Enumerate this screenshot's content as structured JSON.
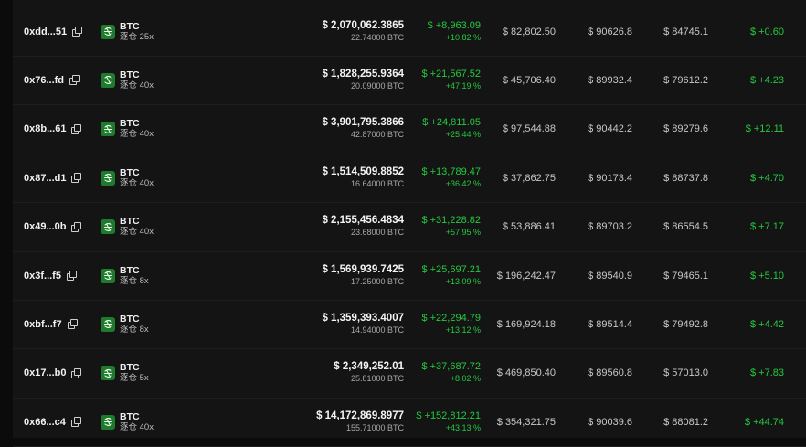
{
  "rows": [
    {
      "address": "0xdd...51",
      "coin": "BTC",
      "leverage": "逐仓 25x",
      "value": "$ 2,070,062.3865",
      "size": "22.74000 BTC",
      "pnl": "$ +8,963.09",
      "pnl_pct": "+10.82 %",
      "entry": "$ 82,802.50",
      "mark": "$ 90626.8",
      "liq": "$ 84745.1",
      "funding": "$ +0.60"
    },
    {
      "address": "0x76...fd",
      "coin": "BTC",
      "leverage": "逐仓 40x",
      "value": "$ 1,828,255.9364",
      "size": "20.09000 BTC",
      "pnl": "$ +21,567.52",
      "pnl_pct": "+47.19 %",
      "entry": "$ 45,706.40",
      "mark": "$ 89932.4",
      "liq": "$ 79612.2",
      "funding": "$ +4.23"
    },
    {
      "address": "0x8b...61",
      "coin": "BTC",
      "leverage": "逐仓 40x",
      "value": "$ 3,901,795.3866",
      "size": "42.87000 BTC",
      "pnl": "$ +24,811.05",
      "pnl_pct": "+25.44 %",
      "entry": "$ 97,544.88",
      "mark": "$ 90442.2",
      "liq": "$ 89279.6",
      "funding": "$ +12.11"
    },
    {
      "address": "0x87...d1",
      "coin": "BTC",
      "leverage": "逐仓 40x",
      "value": "$ 1,514,509.8852",
      "size": "16.64000 BTC",
      "pnl": "$ +13,789.47",
      "pnl_pct": "+36.42 %",
      "entry": "$ 37,862.75",
      "mark": "$ 90173.4",
      "liq": "$ 88737.8",
      "funding": "$ +4.70"
    },
    {
      "address": "0x49...0b",
      "coin": "BTC",
      "leverage": "逐仓 40x",
      "value": "$ 2,155,456.4834",
      "size": "23.68000 BTC",
      "pnl": "$ +31,228.82",
      "pnl_pct": "+57.95 %",
      "entry": "$ 53,886.41",
      "mark": "$ 89703.2",
      "liq": "$ 86554.5",
      "funding": "$ +7.17"
    },
    {
      "address": "0x3f...f5",
      "coin": "BTC",
      "leverage": "逐仓 8x",
      "value": "$ 1,569,939.7425",
      "size": "17.25000 BTC",
      "pnl": "$ +25,697.21",
      "pnl_pct": "+13.09 %",
      "entry": "$ 196,242.47",
      "mark": "$ 89540.9",
      "liq": "$ 79465.1",
      "funding": "$ +5.10"
    },
    {
      "address": "0xbf...f7",
      "coin": "BTC",
      "leverage": "逐仓 8x",
      "value": "$ 1,359,393.4007",
      "size": "14.94000 BTC",
      "pnl": "$ +22,294.79",
      "pnl_pct": "+13.12 %",
      "entry": "$ 169,924.18",
      "mark": "$ 89514.4",
      "liq": "$ 79492.8",
      "funding": "$ +4.42"
    },
    {
      "address": "0x17...b0",
      "coin": "BTC",
      "leverage": "逐仓 5x",
      "value": "$ 2,349,252.01",
      "size": "25.81000 BTC",
      "pnl": "$ +37,687.72",
      "pnl_pct": "+8.02 %",
      "entry": "$ 469,850.40",
      "mark": "$ 89560.8",
      "liq": "$ 57013.0",
      "funding": "$ +7.83"
    },
    {
      "address": "0x66...c4",
      "coin": "BTC",
      "leverage": "逐仓 40x",
      "value": "$ 14,172,869.8977",
      "size": "155.71000 BTC",
      "pnl": "$ +152,812.21",
      "pnl_pct": "+43.13 %",
      "entry": "$ 354,321.75",
      "mark": "$ 90039.6",
      "liq": "$ 88081.2",
      "funding": "$ +44.74"
    }
  ],
  "colors": {
    "background": "#141414",
    "positive": "#25c93f",
    "coin_badge": "#1f7a2e"
  },
  "icons": {
    "copy": "copy-icon",
    "coin": "hyperliquid-coin-icon"
  }
}
